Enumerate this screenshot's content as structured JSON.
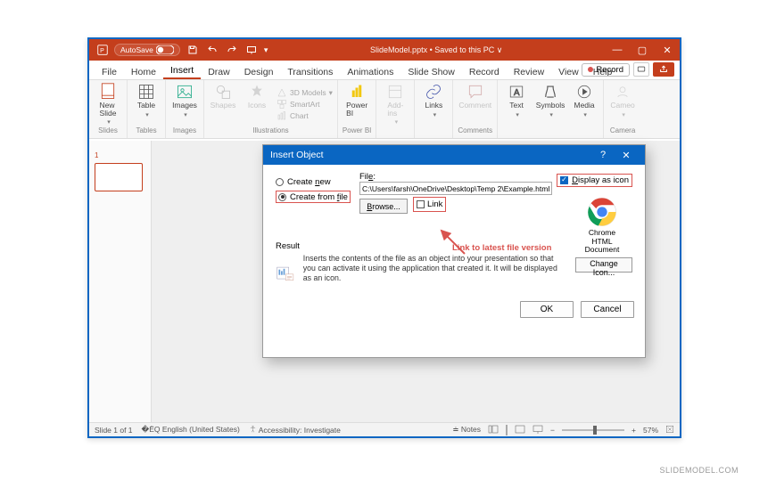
{
  "titlebar": {
    "autosave": "AutoSave",
    "filename": "SlideModel.pptx • Saved to this PC",
    "dropdown_indicator": "∨"
  },
  "tabs": {
    "file": "File",
    "home": "Home",
    "insert": "Insert",
    "draw": "Draw",
    "design": "Design",
    "transitions": "Transitions",
    "animations": "Animations",
    "slideshow": "Slide Show",
    "record": "Record",
    "review": "Review",
    "view": "View",
    "help": "Help",
    "record_btn": "Record"
  },
  "ribbon": {
    "new_slide": "New\nSlide",
    "table": "Table",
    "images": "Images",
    "shapes": "Shapes",
    "icons": "Icons",
    "models3d": "3D Models",
    "smartart": "SmartArt",
    "chart": "Chart",
    "powerbi": "Power\nBI",
    "addins": "Add-\nins",
    "links": "Links",
    "comment": "Comment",
    "text": "Text",
    "symbols": "Symbols",
    "media": "Media",
    "cameo": "Cameo",
    "g_slides": "Slides",
    "g_tables": "Tables",
    "g_images": "Images",
    "g_illustrations": "Illustrations",
    "g_powerbi": "Power BI",
    "g_comments": "Comments",
    "g_camera": "Camera"
  },
  "thumb": {
    "n": "1"
  },
  "dialog": {
    "title": "Insert Object",
    "create_new": "Create new",
    "create_new_key": "n",
    "create_from_file": "Create from file",
    "create_from_file_key": "f",
    "file_label": "File:",
    "file_label_key": "e",
    "path": "C:\\Users\\farsh\\OneDrive\\Desktop\\Temp 2\\Example.html",
    "browse": "Browse...",
    "browse_key": "B",
    "link": "Link",
    "display_as_icon": "Display as icon",
    "display_key": "D",
    "chrome_caption": "Chrome\nHTML\nDocument",
    "change_icon": "Change Icon...",
    "result": "Result",
    "result_text": "Inserts the contents of the file as an object into your presentation so that you can activate it using the application that created it. It will be displayed as an icon.",
    "ok": "OK",
    "cancel": "Cancel"
  },
  "annotation": {
    "text": "Link to latest file version"
  },
  "statusbar": {
    "slide": "Slide 1 of 1",
    "lang": "English (United States)",
    "access": "Accessibility: Investigate",
    "notes": "Notes",
    "zoom": "57%"
  },
  "watermark": "SLIDEMODEL.COM"
}
